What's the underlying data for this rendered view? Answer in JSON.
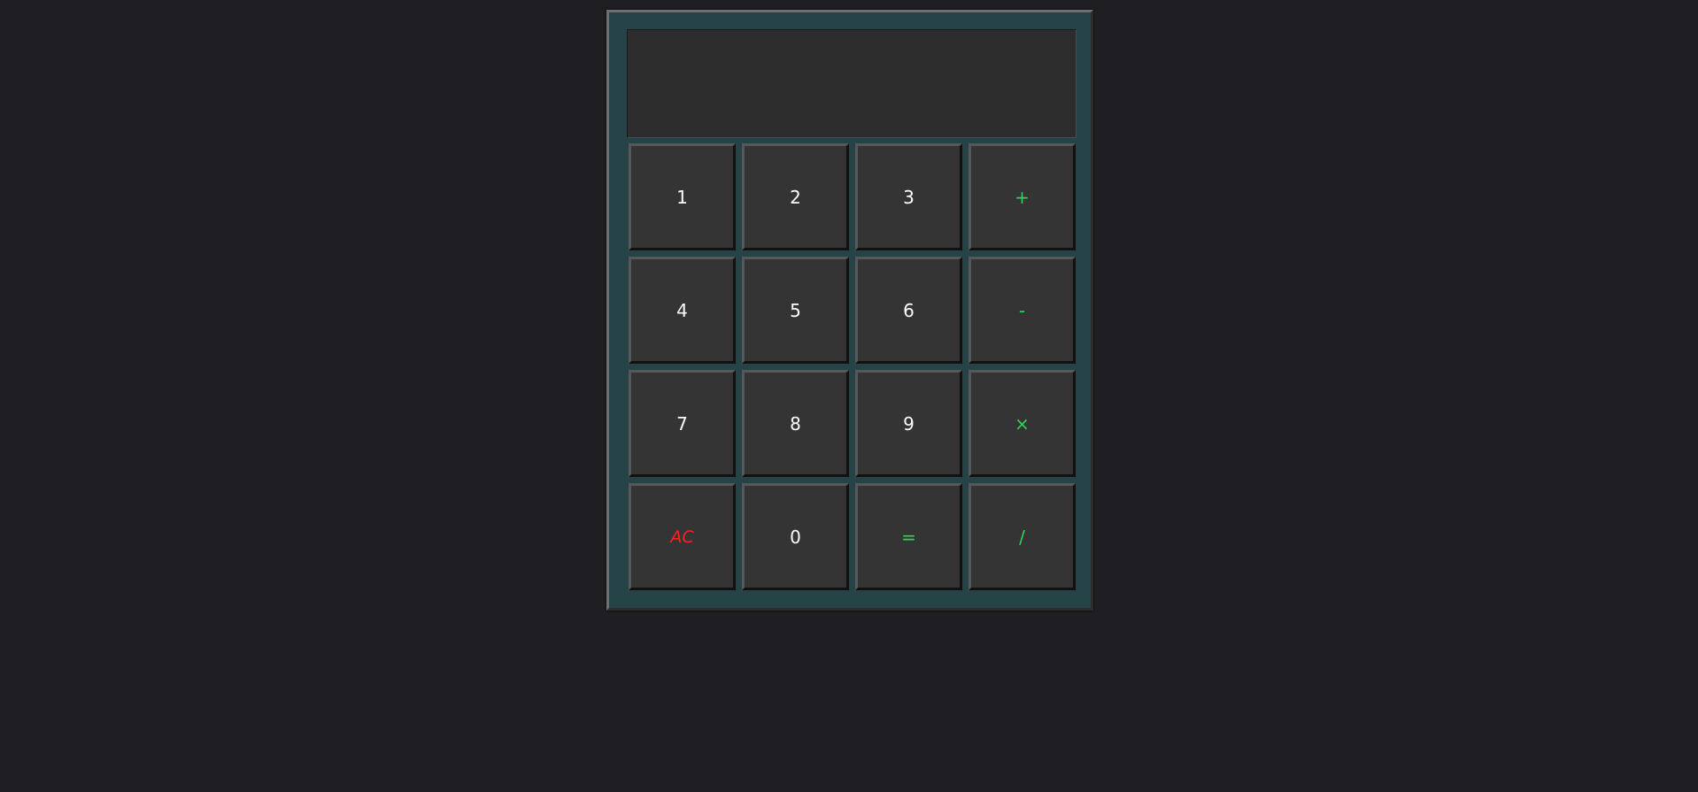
{
  "display": {
    "value": ""
  },
  "keys": [
    {
      "label": "1",
      "kind": "digit"
    },
    {
      "label": "2",
      "kind": "digit"
    },
    {
      "label": "3",
      "kind": "digit"
    },
    {
      "label": "+",
      "kind": "op"
    },
    {
      "label": "4",
      "kind": "digit"
    },
    {
      "label": "5",
      "kind": "digit"
    },
    {
      "label": "6",
      "kind": "digit"
    },
    {
      "label": "-",
      "kind": "op"
    },
    {
      "label": "7",
      "kind": "digit"
    },
    {
      "label": "8",
      "kind": "digit"
    },
    {
      "label": "9",
      "kind": "digit"
    },
    {
      "label": "×",
      "kind": "op"
    },
    {
      "label": "AC",
      "kind": "clear"
    },
    {
      "label": "0",
      "kind": "digit"
    },
    {
      "label": "=",
      "kind": "op"
    },
    {
      "label": "/",
      "kind": "op"
    }
  ],
  "colors": {
    "page_background": "#1f1e22",
    "calculator_body": "#264348",
    "display_background": "#2d2d2d",
    "key_background": "#343434",
    "digit_text": "#ffffff",
    "operator_text": "#2fd35a",
    "clear_text": "#ff2020"
  }
}
